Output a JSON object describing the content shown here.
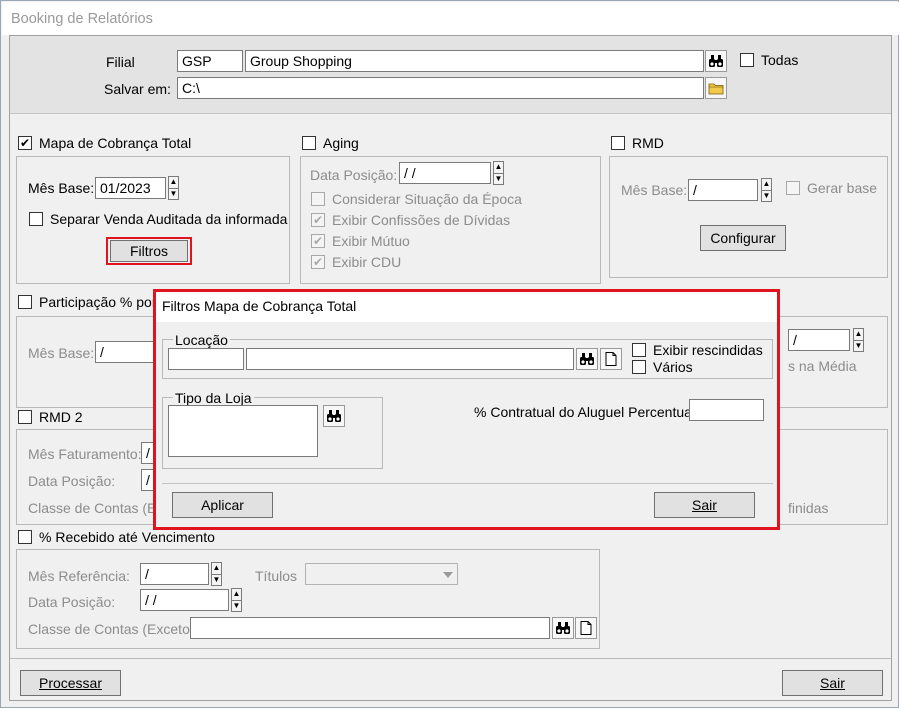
{
  "window": {
    "title": "Booking de Relatórios"
  },
  "header": {
    "filial_label": "Filial",
    "filial_code": "GSP",
    "filial_name": "Group Shopping",
    "todas_label": "Todas",
    "salvar_label": "Salvar em:",
    "salvar_path": "C:\\"
  },
  "mapa": {
    "label": "Mapa de Cobrança Total",
    "checked": true,
    "mes_base_label": "Mês Base:",
    "mes_base_value": "01/2023",
    "separar_label": "Separar Venda Auditada da informada",
    "filtros_button": "Filtros"
  },
  "aging": {
    "label": "Aging",
    "data_posicao_label": "Data Posição:",
    "data_posicao_value": " / /",
    "options": [
      {
        "label": "Considerar Situação da Época",
        "checked": false
      },
      {
        "label": "Exibir Confissões de Dívidas",
        "checked": true
      },
      {
        "label": "Exibir Mútuo",
        "checked": true
      },
      {
        "label": "Exibir CDU",
        "checked": true
      }
    ]
  },
  "rmd": {
    "label": "RMD",
    "mes_base_label": "Mês Base:",
    "mes_base_value": " /",
    "gerar_base_label": "Gerar base",
    "configurar_button": "Configurar"
  },
  "participacao": {
    "label": "Participação % por",
    "mes_base_label": "Mês Base:",
    "mes_base_value": " /",
    "right_value": " /",
    "right_text": "s na Média"
  },
  "rmd2": {
    "label": "RMD 2",
    "mes_faturamento_label": "Mês Faturamento:",
    "mes_faturamento_value": "/",
    "data_posicao_label": "Data Posição:",
    "data_posicao_value": "/",
    "classe_label": "Classe de Contas (Ex",
    "right_text": "finidas"
  },
  "recebido": {
    "label": "% Recebido até Vencimento",
    "mes_ref_label": "Mês Referência:",
    "mes_ref_value": " /",
    "titulos_label": "Títulos",
    "data_posicao_label": "Data Posição:",
    "data_posicao_value": " / /",
    "classe_label": "Classe de Contas (Exceto)"
  },
  "footer": {
    "processar_button": "Processar",
    "sair_button": "Sair"
  },
  "dialog": {
    "title": "Filtros Mapa de Cobrança Total",
    "locacao_label": "Locação",
    "exibir_rescindidas_label": "Exibir rescindidas",
    "varios_label": "Vários",
    "tipo_loja_label": "Tipo da Loja",
    "contratual_label": "% Contratual do Aluguel Percentual",
    "aplicar_button": "Aplicar",
    "sair_button": "Sair"
  },
  "colors": {
    "highlight": "#e0141e",
    "folder": "#f2c94c"
  }
}
